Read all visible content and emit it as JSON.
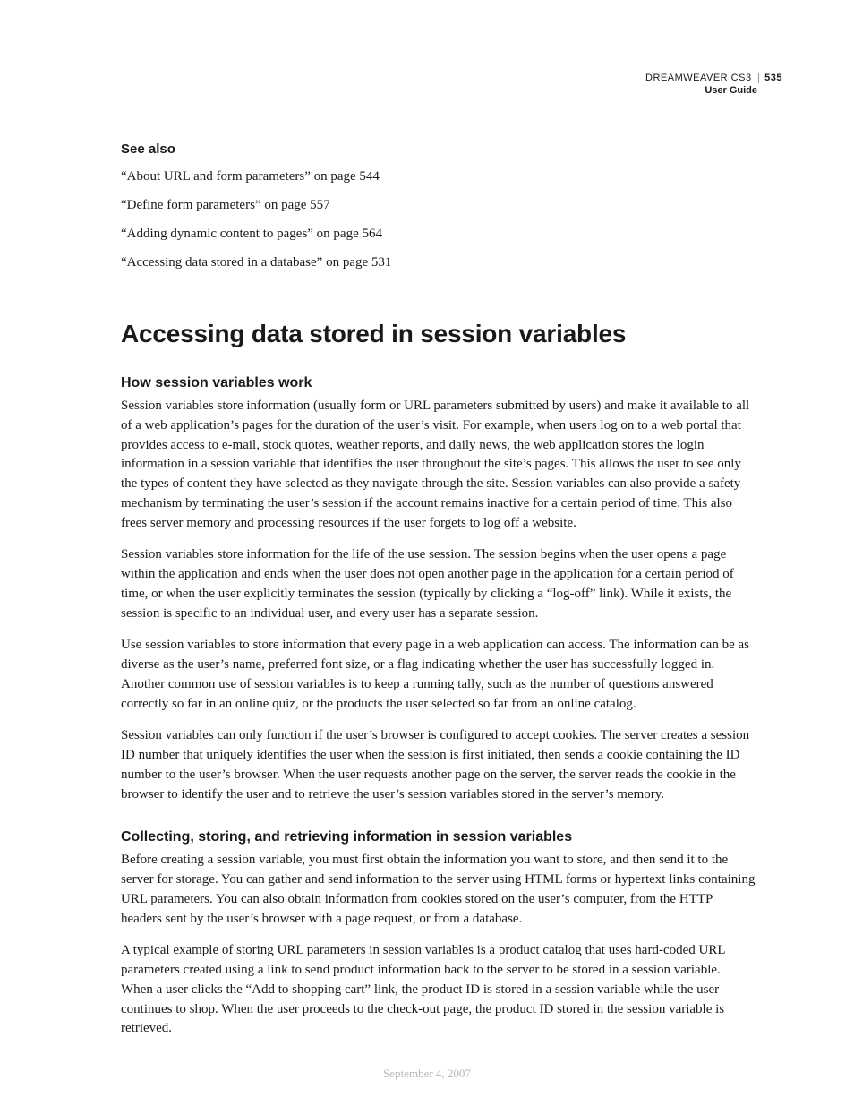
{
  "header": {
    "product": "DREAMWEAVER CS3",
    "page_number": "535",
    "subtitle": "User Guide"
  },
  "see_also": {
    "heading": "See also",
    "links": [
      "“About URL and form parameters” on page 544",
      "“Define form parameters” on page 557",
      "“Adding dynamic content to pages” on page 564",
      "“Accessing data stored in a database” on page 531"
    ]
  },
  "title": "Accessing data stored in session variables",
  "sections": [
    {
      "heading": "How session variables work",
      "paragraphs": [
        "Session variables store information (usually form or URL parameters submitted by users) and make it available to all of a web application’s pages for the duration of the user’s visit. For example, when users log on to a web portal that provides access to e-mail, stock quotes, weather reports, and daily news, the web application stores the login information in a session variable that identifies the user throughout the site’s pages. This allows the user to see only the types of content they have selected as they navigate through the site. Session variables can also provide a safety mechanism by terminating the user’s session if the account remains inactive for a certain period of time. This also frees server memory and processing resources if the user forgets to log off a website.",
        "Session variables store information for the life of the use session. The session begins when the user opens a page within the application and ends when the user does not open another page in the application for a certain period of time, or when the user explicitly terminates the session (typically by clicking a “log-off” link). While it exists, the session is specific to an individual user, and every user has a separate session.",
        "Use session variables to store information that every page in a web application can access. The information can be as diverse as the user’s name, preferred font size, or a flag indicating whether the user has successfully logged in. Another common use of session variables is to keep a running tally, such as the number of questions answered correctly so far in an online quiz, or the products the user selected so far from an online catalog.",
        "Session variables can only function if the user’s browser is configured to accept cookies. The server creates a session ID number that uniquely identifies the user when the session is first initiated, then sends a cookie containing the ID number to the user’s browser. When the user requests another page on the server, the server reads the cookie in the browser to identify the user and to retrieve the user’s session variables stored in the server’s memory."
      ]
    },
    {
      "heading": "Collecting, storing, and retrieving information in session variables",
      "paragraphs": [
        "Before creating a session variable, you must first obtain the information you want to store, and then send it to the server for storage. You can gather and send information to the server using HTML forms or hypertext links containing URL parameters. You can also obtain information from cookies stored on the user’s computer, from the HTTP headers sent by the user’s browser with a page request, or from a database.",
        "A typical example of storing URL parameters in session variables is a product catalog that uses hard-coded URL parameters created using a link to send product information back to the server to be stored in a session variable. When a user clicks the “Add to shopping cart” link, the product ID is stored in a session variable while the user continues to shop. When the user proceeds to the check-out page, the product ID stored in the session variable is retrieved."
      ]
    }
  ],
  "footer_date": "September 4, 2007"
}
